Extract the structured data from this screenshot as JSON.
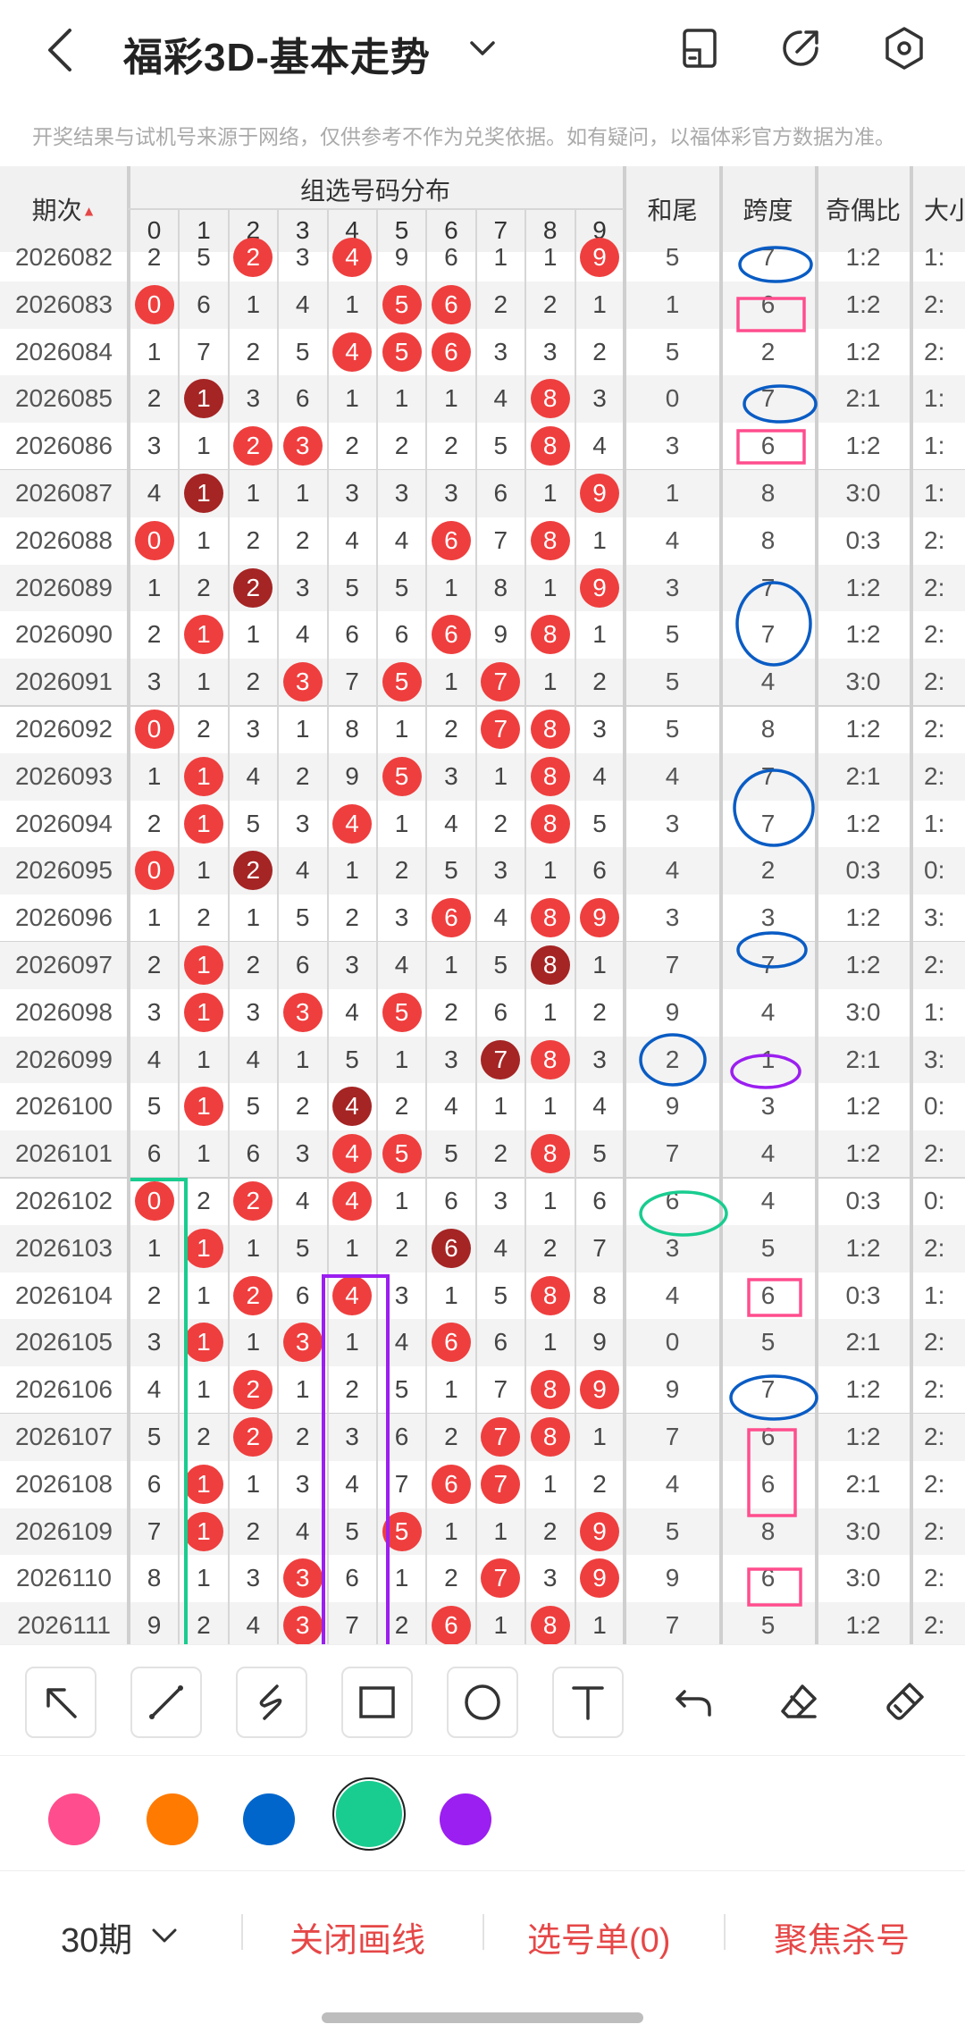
{
  "header": {
    "title": "福彩3D-基本走势",
    "notice": "开奖结果与试机号来源于网络，仅供参考不作为兑奖依据。如有疑问，以福体彩官方数据为准。"
  },
  "table": {
    "col_issue": "期次",
    "col_group": "组选号码分布",
    "digits": [
      "0",
      "1",
      "2",
      "3",
      "4",
      "5",
      "6",
      "7",
      "8",
      "9"
    ],
    "col_sum": "和尾",
    "col_span": "跨度",
    "col_oe": "奇偶比",
    "col_bs": "大小"
  },
  "rows": [
    {
      "issue": "2026082",
      "d": [
        "2",
        "5",
        "2",
        "3",
        "4",
        "9",
        "6",
        "1",
        "1",
        "9"
      ],
      "hits": [
        2,
        4,
        9
      ],
      "dark": [],
      "sum": "5",
      "span": "7",
      "oe": "1:2",
      "bs": "1:"
    },
    {
      "issue": "2026083",
      "d": [
        "0",
        "6",
        "1",
        "4",
        "1",
        "5",
        "6",
        "2",
        "2",
        "1"
      ],
      "hits": [
        0,
        5,
        6
      ],
      "dark": [],
      "sum": "1",
      "span": "6",
      "oe": "1:2",
      "bs": "2:"
    },
    {
      "issue": "2026084",
      "d": [
        "1",
        "7",
        "2",
        "5",
        "4",
        "5",
        "6",
        "3",
        "3",
        "2"
      ],
      "hits": [
        4,
        5,
        6
      ],
      "dark": [],
      "sum": "5",
      "span": "2",
      "oe": "1:2",
      "bs": "2:"
    },
    {
      "issue": "2026085",
      "d": [
        "2",
        "1",
        "3",
        "6",
        "1",
        "1",
        "1",
        "4",
        "8",
        "3"
      ],
      "hits": [
        8
      ],
      "dark": [
        1
      ],
      "sum": "0",
      "span": "7",
      "oe": "2:1",
      "bs": "1:"
    },
    {
      "issue": "2026086",
      "d": [
        "3",
        "1",
        "2",
        "3",
        "2",
        "2",
        "2",
        "5",
        "8",
        "4"
      ],
      "hits": [
        2,
        3,
        8
      ],
      "dark": [],
      "sum": "3",
      "span": "6",
      "oe": "1:2",
      "bs": "1:"
    },
    {
      "issue": "2026087",
      "d": [
        "4",
        "1",
        "1",
        "1",
        "3",
        "3",
        "3",
        "6",
        "1",
        "9"
      ],
      "hits": [
        9
      ],
      "dark": [
        1
      ],
      "sum": "1",
      "span": "8",
      "oe": "3:0",
      "bs": "1:"
    },
    {
      "issue": "2026088",
      "d": [
        "0",
        "1",
        "2",
        "2",
        "4",
        "4",
        "6",
        "7",
        "8",
        "1"
      ],
      "hits": [
        0,
        6,
        8
      ],
      "dark": [],
      "sum": "4",
      "span": "8",
      "oe": "0:3",
      "bs": "2:"
    },
    {
      "issue": "2026089",
      "d": [
        "1",
        "2",
        "2",
        "3",
        "5",
        "5",
        "1",
        "8",
        "1",
        "9"
      ],
      "hits": [
        9
      ],
      "dark": [
        2
      ],
      "sum": "3",
      "span": "7",
      "oe": "1:2",
      "bs": "2:"
    },
    {
      "issue": "2026090",
      "d": [
        "2",
        "1",
        "1",
        "4",
        "6",
        "6",
        "6",
        "9",
        "8",
        "1"
      ],
      "hits": [
        1,
        6,
        8
      ],
      "dark": [],
      "sum": "5",
      "span": "7",
      "oe": "1:2",
      "bs": "2:"
    },
    {
      "issue": "2026091",
      "d": [
        "3",
        "1",
        "2",
        "3",
        "7",
        "5",
        "1",
        "7",
        "1",
        "2"
      ],
      "hits": [
        3,
        5,
        7
      ],
      "dark": [],
      "sum": "5",
      "span": "4",
      "oe": "3:0",
      "bs": "2:"
    },
    {
      "issue": "2026092",
      "d": [
        "0",
        "2",
        "3",
        "1",
        "8",
        "1",
        "2",
        "7",
        "8",
        "3"
      ],
      "hits": [
        0,
        7,
        8
      ],
      "dark": [],
      "sum": "5",
      "span": "8",
      "oe": "1:2",
      "bs": "2:"
    },
    {
      "issue": "2026093",
      "d": [
        "1",
        "1",
        "4",
        "2",
        "9",
        "5",
        "3",
        "1",
        "8",
        "4"
      ],
      "hits": [
        1,
        5,
        8
      ],
      "dark": [],
      "sum": "4",
      "span": "7",
      "oe": "2:1",
      "bs": "2:"
    },
    {
      "issue": "2026094",
      "d": [
        "2",
        "1",
        "5",
        "3",
        "4",
        "1",
        "4",
        "2",
        "8",
        "5"
      ],
      "hits": [
        1,
        4,
        8
      ],
      "dark": [],
      "sum": "3",
      "span": "7",
      "oe": "1:2",
      "bs": "1:"
    },
    {
      "issue": "2026095",
      "d": [
        "0",
        "1",
        "2",
        "4",
        "1",
        "2",
        "5",
        "3",
        "1",
        "6"
      ],
      "hits": [
        0
      ],
      "dark": [
        2
      ],
      "sum": "4",
      "span": "2",
      "oe": "0:3",
      "bs": "0:"
    },
    {
      "issue": "2026096",
      "d": [
        "1",
        "2",
        "1",
        "5",
        "2",
        "3",
        "6",
        "4",
        "8",
        "9"
      ],
      "hits": [
        6,
        8,
        9
      ],
      "dark": [],
      "sum": "3",
      "span": "3",
      "oe": "1:2",
      "bs": "3:"
    },
    {
      "issue": "2026097",
      "d": [
        "2",
        "1",
        "2",
        "6",
        "3",
        "4",
        "1",
        "5",
        "8",
        "1"
      ],
      "hits": [
        1
      ],
      "dark": [
        8
      ],
      "sum": "7",
      "span": "7",
      "oe": "1:2",
      "bs": "2:"
    },
    {
      "issue": "2026098",
      "d": [
        "3",
        "1",
        "3",
        "3",
        "4",
        "5",
        "2",
        "6",
        "1",
        "2"
      ],
      "hits": [
        1,
        3,
        5
      ],
      "dark": [],
      "sum": "9",
      "span": "4",
      "oe": "3:0",
      "bs": "1:"
    },
    {
      "issue": "2026099",
      "d": [
        "4",
        "1",
        "4",
        "1",
        "5",
        "1",
        "3",
        "7",
        "8",
        "3"
      ],
      "hits": [
        8
      ],
      "dark": [
        7
      ],
      "sum": "2",
      "span": "1",
      "oe": "2:1",
      "bs": "3:"
    },
    {
      "issue": "2026100",
      "d": [
        "5",
        "1",
        "5",
        "2",
        "4",
        "2",
        "4",
        "1",
        "1",
        "4"
      ],
      "hits": [
        1
      ],
      "dark": [
        4
      ],
      "sum": "9",
      "span": "3",
      "oe": "1:2",
      "bs": "0:"
    },
    {
      "issue": "2026101",
      "d": [
        "6",
        "1",
        "6",
        "3",
        "4",
        "5",
        "5",
        "2",
        "8",
        "5"
      ],
      "hits": [
        4,
        5,
        8
      ],
      "dark": [],
      "sum": "7",
      "span": "4",
      "oe": "1:2",
      "bs": "2:"
    },
    {
      "issue": "2026102",
      "d": [
        "0",
        "2",
        "2",
        "4",
        "4",
        "1",
        "6",
        "3",
        "1",
        "6"
      ],
      "hits": [
        0,
        2,
        4
      ],
      "dark": [],
      "sum": "6",
      "span": "4",
      "oe": "0:3",
      "bs": "0:"
    },
    {
      "issue": "2026103",
      "d": [
        "1",
        "1",
        "1",
        "5",
        "1",
        "2",
        "6",
        "4",
        "2",
        "7"
      ],
      "hits": [
        1
      ],
      "dark": [
        6
      ],
      "sum": "3",
      "span": "5",
      "oe": "1:2",
      "bs": "2:"
    },
    {
      "issue": "2026104",
      "d": [
        "2",
        "1",
        "2",
        "6",
        "4",
        "3",
        "1",
        "5",
        "8",
        "8"
      ],
      "hits": [
        2,
        4,
        8
      ],
      "dark": [],
      "sum": "4",
      "span": "6",
      "oe": "0:3",
      "bs": "1:"
    },
    {
      "issue": "2026105",
      "d": [
        "3",
        "1",
        "1",
        "3",
        "1",
        "4",
        "6",
        "6",
        "1",
        "9"
      ],
      "hits": [
        1,
        3,
        6
      ],
      "dark": [],
      "sum": "0",
      "span": "5",
      "oe": "2:1",
      "bs": "2:"
    },
    {
      "issue": "2026106",
      "d": [
        "4",
        "1",
        "2",
        "1",
        "2",
        "5",
        "1",
        "7",
        "8",
        "9"
      ],
      "hits": [
        2,
        8,
        9
      ],
      "dark": [],
      "sum": "9",
      "span": "7",
      "oe": "1:2",
      "bs": "2:"
    },
    {
      "issue": "2026107",
      "d": [
        "5",
        "2",
        "2",
        "2",
        "3",
        "6",
        "2",
        "7",
        "8",
        "1"
      ],
      "hits": [
        2,
        7,
        8
      ],
      "dark": [],
      "sum": "7",
      "span": "6",
      "oe": "1:2",
      "bs": "2:"
    },
    {
      "issue": "2026108",
      "d": [
        "6",
        "1",
        "1",
        "3",
        "4",
        "7",
        "6",
        "7",
        "1",
        "2"
      ],
      "hits": [
        1,
        6,
        7
      ],
      "dark": [],
      "sum": "4",
      "span": "6",
      "oe": "2:1",
      "bs": "2:"
    },
    {
      "issue": "2026109",
      "d": [
        "7",
        "1",
        "2",
        "4",
        "5",
        "5",
        "1",
        "1",
        "2",
        "9"
      ],
      "hits": [
        1,
        5,
        9
      ],
      "dark": [],
      "sum": "5",
      "span": "8",
      "oe": "3:0",
      "bs": "2:"
    },
    {
      "issue": "2026110",
      "d": [
        "8",
        "1",
        "3",
        "3",
        "6",
        "1",
        "2",
        "7",
        "3",
        "9"
      ],
      "hits": [
        3,
        7,
        9
      ],
      "dark": [],
      "sum": "9",
      "span": "6",
      "oe": "3:0",
      "bs": "2:"
    },
    {
      "issue": "2026111",
      "d": [
        "9",
        "2",
        "4",
        "3",
        "7",
        "2",
        "6",
        "1",
        "8",
        "1"
      ],
      "hits": [
        3,
        6,
        8
      ],
      "dark": [],
      "sum": "7",
      "span": "5",
      "oe": "1:2",
      "bs": "2:"
    }
  ],
  "toolbar": {
    "tools": [
      "arrow-icon",
      "line-icon",
      "freehand-icon",
      "rectangle-icon",
      "circle-icon",
      "text-icon",
      "undo-icon",
      "eraser-icon",
      "clear-brush-icon"
    ]
  },
  "palette": {
    "colors": [
      "#ff4d8d",
      "#ff7a00",
      "#0066cc",
      "#19cc8f",
      "#9b1ff0"
    ],
    "selected_index": 3
  },
  "bottom": {
    "period": "30期",
    "close_draw": "关闭画线",
    "pick_list": "选号单(0)",
    "focus_kill": "聚焦杀号"
  }
}
